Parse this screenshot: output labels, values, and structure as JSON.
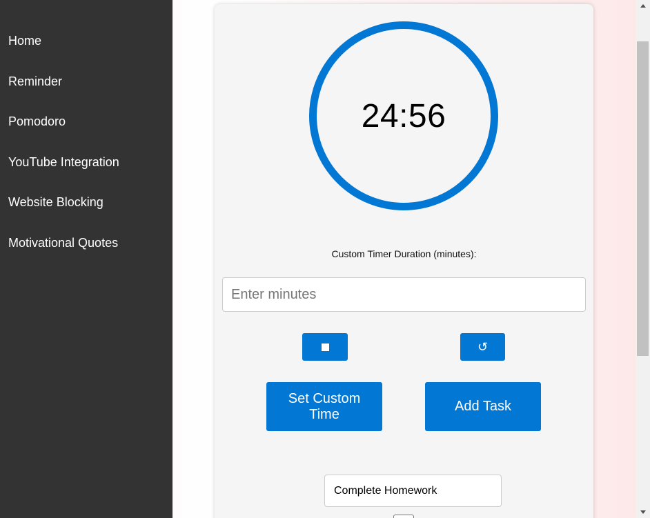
{
  "sidebar": {
    "items": [
      {
        "label": "Home"
      },
      {
        "label": "Reminder"
      },
      {
        "label": "Pomodoro"
      },
      {
        "label": "YouTube Integration"
      },
      {
        "label": "Website Blocking"
      },
      {
        "label": "Motivational Quotes"
      }
    ]
  },
  "timer": {
    "display": "24:56",
    "ring_color": "#0277d3"
  },
  "custom": {
    "label": "Custom Timer Duration (minutes):",
    "placeholder": "Enter minutes",
    "value": ""
  },
  "controls": {
    "stop_icon": "stop-icon",
    "reset_icon": "reset-icon",
    "reset_glyph": "↺",
    "set_custom_label": "Set Custom Time",
    "add_task_label": "Add Task",
    "accent": "#0277d3"
  },
  "task": {
    "value": "Complete Homework"
  }
}
